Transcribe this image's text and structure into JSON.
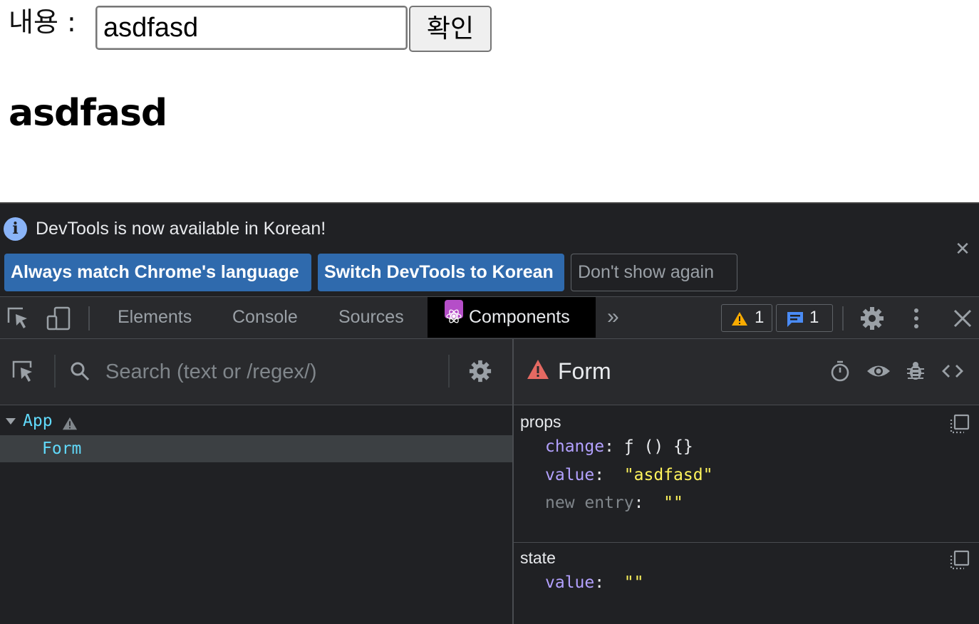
{
  "page": {
    "label": "내용 :",
    "input_value": "asdfasd",
    "confirm_button": "확인",
    "heading": "asdfasd"
  },
  "devtools": {
    "infobar": {
      "message": "DevTools is now available in Korean!",
      "btn_match": "Always match Chrome's language",
      "btn_switch": "Switch DevTools to Korean",
      "btn_dismiss": "Don't show again"
    },
    "tabs": {
      "elements": "Elements",
      "console": "Console",
      "sources": "Sources",
      "components": "Components"
    },
    "warnings_count": "1",
    "messages_count": "1",
    "search": {
      "placeholder": "Search (text or /regex/)"
    },
    "tree": {
      "root": "App",
      "child": "Form"
    },
    "inspector": {
      "component_name": "Form",
      "props_title": "props",
      "props": {
        "change_key": "change",
        "change_value": "ƒ () {}",
        "value_key": "value",
        "value_value": "\"asdfasd\"",
        "new_entry_key": "new entry",
        "new_entry_value": "\"\""
      },
      "state_title": "state",
      "state": {
        "value_key": "value",
        "value_value": "\"\""
      }
    },
    "colors": {
      "accent_button": "#2f6aad",
      "component_name": "#61dafb",
      "prop_key": "#b3a1ff",
      "string_value": "#fff45c",
      "warning_red": "#e46962"
    }
  }
}
